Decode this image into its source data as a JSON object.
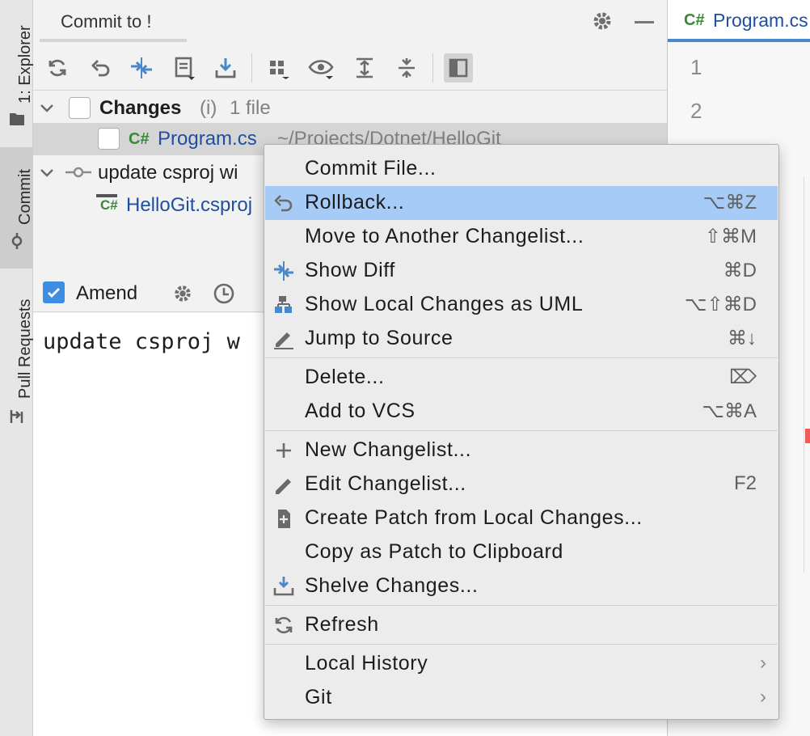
{
  "strip": {
    "explorer_label": "1: Explorer",
    "commit_label": "Commit",
    "pull_requests_label": "Pull Requests"
  },
  "commit_panel": {
    "title": "Commit to !",
    "toolbar_icons": [
      "refresh-icon",
      "rollback-icon",
      "show-diff-icon",
      "changelist-icon",
      "update-icon",
      "group-by-icon",
      "view-options-icon",
      "expand-all-icon",
      "collapse-all-icon",
      "preview-diff-icon"
    ]
  },
  "tree": {
    "changes_label": "Changes",
    "changes_hint": "(i)",
    "changes_count": "1 file",
    "file_lang": "C#",
    "file_name": "Program.cs",
    "file_path": "~/Projects/Dotnet/HelloGit",
    "commit_label": "update csproj wi",
    "csproj_name": "HelloGit.csproj"
  },
  "amend": {
    "label": "Amend",
    "checked": true
  },
  "commit_message": "update csproj w",
  "editor": {
    "tab_lang": "C#",
    "tab_label": "Program.cs",
    "line_numbers": [
      "1",
      "2"
    ]
  },
  "menu": {
    "items": [
      {
        "label": "Commit File...",
        "shortcut": "",
        "icon": ""
      },
      {
        "label": "Rollback...",
        "shortcut": "⌥⌘Z",
        "icon": "rollback-icon",
        "highlighted": true
      },
      {
        "label": "Move to Another Changelist...",
        "shortcut": "⇧⌘M",
        "icon": ""
      },
      {
        "label": "Show Diff",
        "shortcut": "⌘D",
        "icon": "diff-icon"
      },
      {
        "label": "Show Local Changes as UML",
        "shortcut": "⌥⇧⌘D",
        "icon": "uml-icon"
      },
      {
        "label": "Jump to Source",
        "shortcut": "⌘↓",
        "icon": "pencil-icon"
      },
      {
        "label": "Delete...",
        "shortcut": "⌦",
        "icon": ""
      },
      {
        "label": "Add to VCS",
        "shortcut": "⌥⌘A",
        "icon": ""
      },
      {
        "label": "New Changelist...",
        "shortcut": "",
        "icon": "plus-icon"
      },
      {
        "label": "Edit Changelist...",
        "shortcut": "F2",
        "icon": "pencil-icon"
      },
      {
        "label": "Create Patch from Local Changes...",
        "shortcut": "",
        "icon": "patch-icon"
      },
      {
        "label": "Copy as Patch to Clipboard",
        "shortcut": "",
        "icon": ""
      },
      {
        "label": "Shelve Changes...",
        "shortcut": "",
        "icon": "shelve-icon"
      },
      {
        "label": "Refresh",
        "shortcut": "",
        "icon": "refresh-icon"
      },
      {
        "label": "Local History",
        "shortcut": "›",
        "icon": ""
      },
      {
        "label": "Git",
        "shortcut": "›",
        "icon": ""
      }
    ]
  },
  "colors": {
    "selection": "#a6cbf6",
    "link_blue": "#1e4fa0",
    "csharp_green": "#388a34",
    "icon_blue": "#4a88c7"
  }
}
